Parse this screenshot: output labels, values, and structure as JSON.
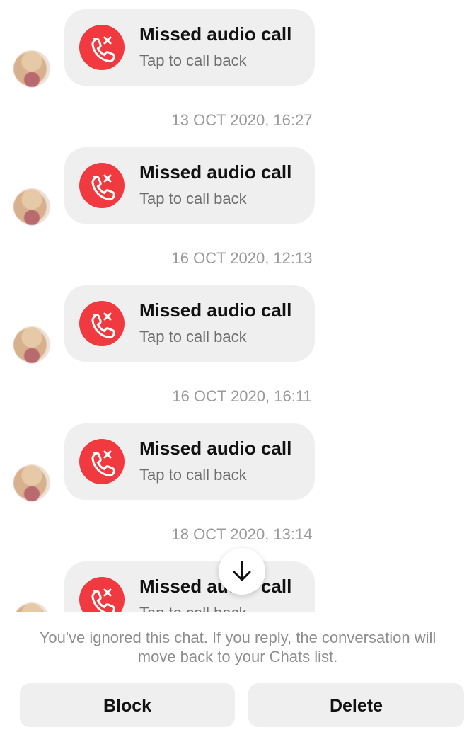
{
  "calls": [
    {
      "title": "Missed audio call",
      "subtitle": "Tap to call back"
    },
    {
      "title": "Missed audio call",
      "subtitle": "Tap to call back"
    },
    {
      "title": "Missed audio call",
      "subtitle": "Tap to call back"
    },
    {
      "title": "Missed audio call",
      "subtitle": "Tap to call back"
    },
    {
      "title": "Missed audio call",
      "subtitle": "Tap to call back"
    }
  ],
  "timestamps": [
    "13 OCT 2020, 16:27",
    "16 OCT 2020, 12:13",
    "16 OCT 2020, 16:11",
    "18 OCT 2020, 13:14"
  ],
  "icons": {
    "call": "missed-call-icon",
    "scroll": "arrow-down-icon"
  },
  "colors": {
    "missed_call_red": "#f03a3f",
    "bubble_gray": "#efefef",
    "timestamp_gray": "#9a9a9a"
  },
  "footer": {
    "notice": "You've ignored this chat. If you reply, the conversation will move back to your Chats list.",
    "block_label": "Block",
    "delete_label": "Delete"
  }
}
